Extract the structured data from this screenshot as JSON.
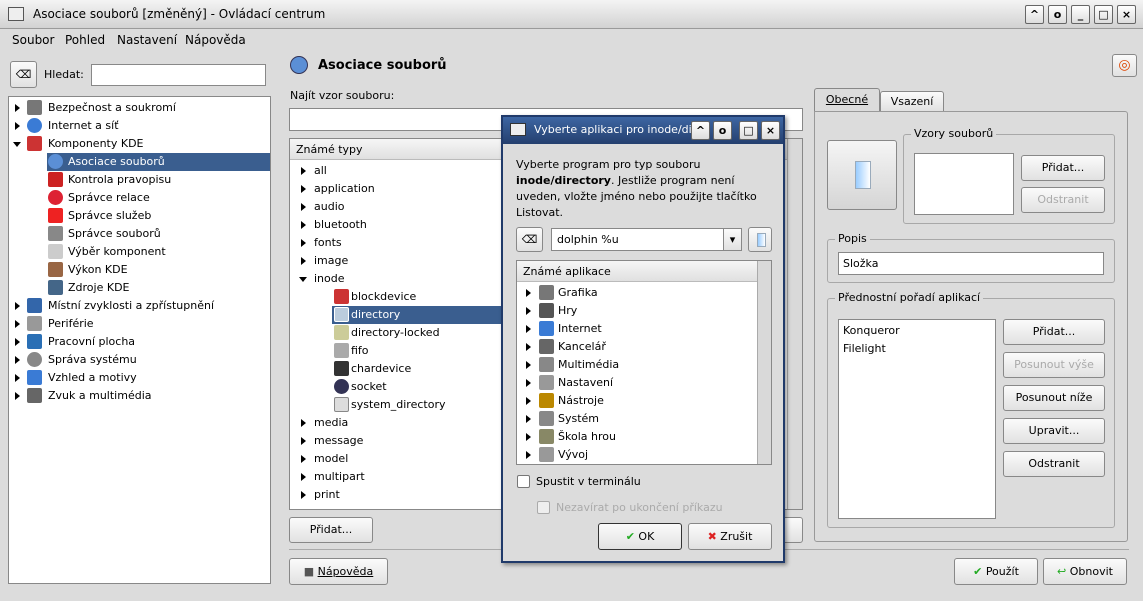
{
  "window": {
    "title": "Asociace souborů [změněný] - Ovládací centrum"
  },
  "menu": [
    "Soubor",
    "Pohled",
    "Nastavení",
    "Nápověda"
  ],
  "search": {
    "label": "Hledat:",
    "value": ""
  },
  "sidebar": {
    "items": [
      {
        "label": "Bezpečnost a soukromí",
        "color": "#777"
      },
      {
        "label": "Internet a síť",
        "color": "#3a7bd5"
      },
      {
        "label": "Komponenty KDE",
        "color": "#c33"
      },
      {
        "label": "Asociace souborů",
        "color": "#5b8fd6"
      },
      {
        "label": "Kontrola pravopisu",
        "color": "#c22"
      },
      {
        "label": "Správce relace",
        "color": "#d23"
      },
      {
        "label": "Správce služeb",
        "color": "#e22"
      },
      {
        "label": "Správce souborů",
        "color": "#888"
      },
      {
        "label": "Výběr komponent",
        "color": "#ccc"
      },
      {
        "label": "Výkon KDE",
        "color": "#964"
      },
      {
        "label": "Zdroje KDE",
        "color": "#468"
      },
      {
        "label": "Místní zvyklosti a zpřístupnění",
        "color": "#3366aa"
      },
      {
        "label": "Periférie",
        "color": "#999"
      },
      {
        "label": "Pracovní plocha",
        "color": "#2a6fb5"
      },
      {
        "label": "Správa systému",
        "color": "#888"
      },
      {
        "label": "Vzhled a motivy",
        "color": "#3a7bd5"
      },
      {
        "label": "Zvuk a multimédia",
        "color": "#666"
      }
    ]
  },
  "module": {
    "title": "Asociace souborů",
    "find_label": "Najít vzor souboru:",
    "find_value": "",
    "types_header": "Známé typy"
  },
  "types": [
    "all",
    "application",
    "audio",
    "bluetooth",
    "fonts",
    "image",
    "inode",
    "blockdevice",
    "directory",
    "directory-locked",
    "fifo",
    "chardevice",
    "socket",
    "system_directory",
    "media",
    "message",
    "model",
    "multipart",
    "print"
  ],
  "buttons": {
    "add": "Přidat...",
    "help": "Nápověda",
    "apply": "Použít",
    "reset": "Obnovit"
  },
  "tabs": [
    "Obecné",
    "Vsazení"
  ],
  "general": {
    "patterns_legend": "Vzory souborů",
    "pattern_add": "Přidat...",
    "pattern_remove": "Odstranit",
    "desc_legend": "Popis",
    "desc_value": "Složka",
    "order_legend": "Přednostní pořadí aplikací",
    "apps": [
      "Konqueror",
      "Filelight"
    ],
    "order_buttons": [
      "Přidat...",
      "Posunout výše",
      "Posunout níže",
      "Upravit...",
      "Odstranit"
    ]
  },
  "dialog": {
    "title": "Vyberte aplikaci pro inode/di",
    "text_1": "Vyberte program pro typ souboru",
    "text_bold": "inode/directory",
    "text_2": ". Jestliže program není uveden, vložte jméno nebo použijte tlačítko Listovat.",
    "command": "dolphin %u",
    "apps_header": "Známé aplikace",
    "apps": [
      {
        "label": "Grafika",
        "color": "#777"
      },
      {
        "label": "Hry",
        "color": "#555"
      },
      {
        "label": "Internet",
        "color": "#3a7bd5"
      },
      {
        "label": "Kancelář",
        "color": "#666"
      },
      {
        "label": "Multimédia",
        "color": "#888"
      },
      {
        "label": "Nastavení",
        "color": "#999"
      },
      {
        "label": "Nástroje",
        "color": "#b80"
      },
      {
        "label": "Systém",
        "color": "#888"
      },
      {
        "label": "Škola hrou",
        "color": "#886"
      },
      {
        "label": "Vývoj",
        "color": "#999"
      }
    ],
    "terminal": "Spustit v terminálu",
    "no_close": "Nezavírat po ukončení příkazu",
    "ok": "OK",
    "cancel": "Zrušit"
  }
}
